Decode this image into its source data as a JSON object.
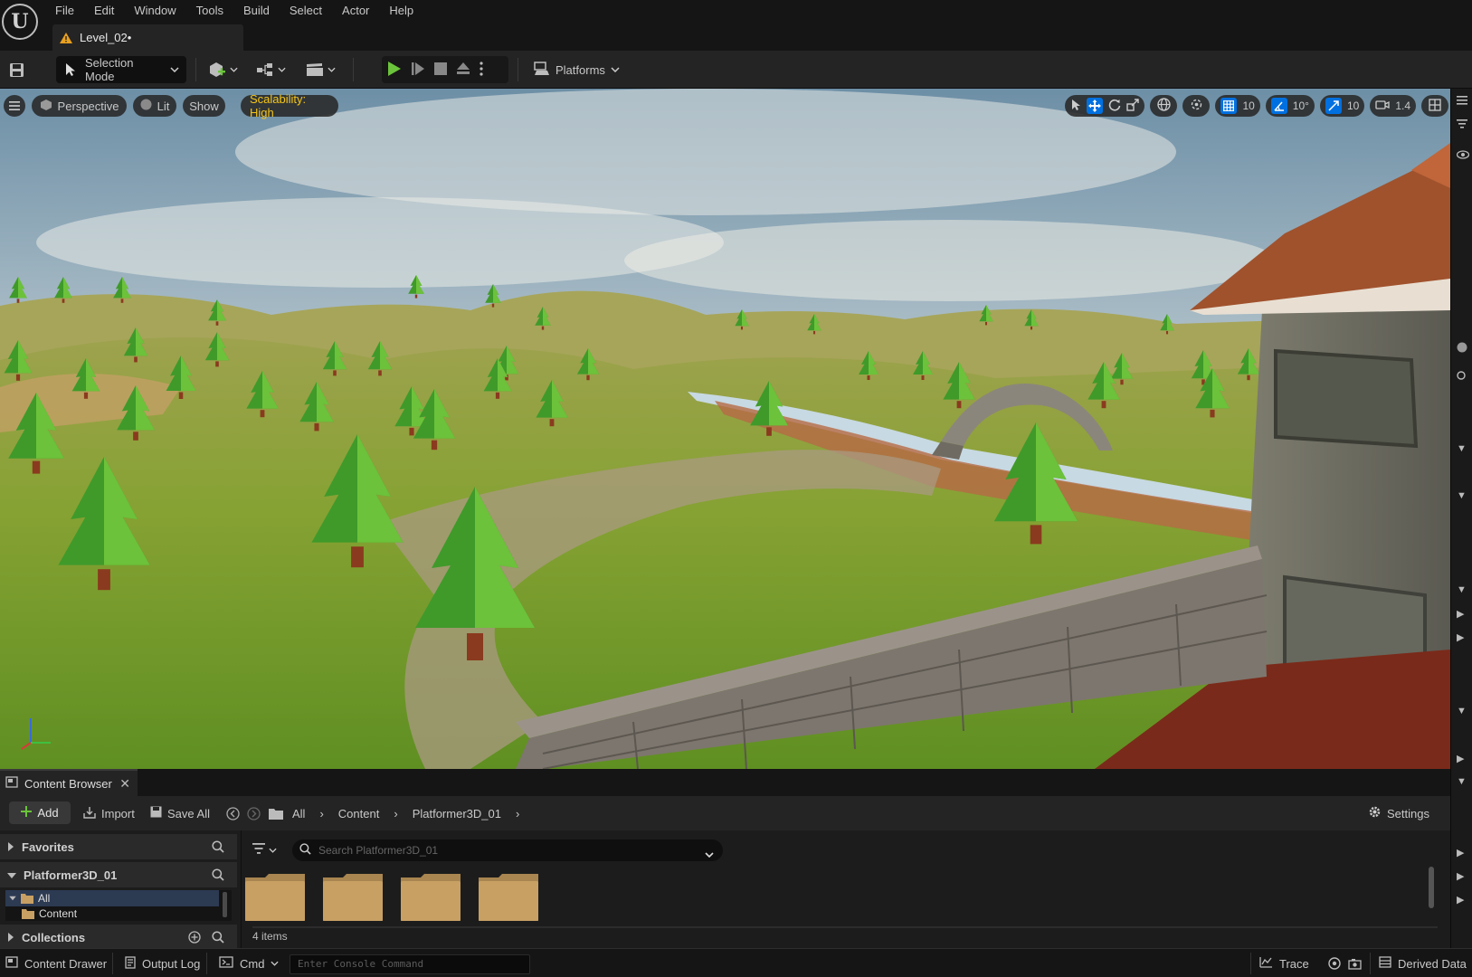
{
  "menubar": {
    "items": [
      "File",
      "Edit",
      "Window",
      "Tools",
      "Build",
      "Select",
      "Actor",
      "Help"
    ],
    "level_tab": "Level_02•"
  },
  "toolbar": {
    "selection_mode": "Selection Mode",
    "platforms": "Platforms"
  },
  "viewport": {
    "perspective": "Perspective",
    "lit": "Lit",
    "show": "Show",
    "scalability": "Scalability: High",
    "grid_snap": "10",
    "rotation_snap": "10°",
    "scale_snap": "10",
    "camera_speed": "1.4"
  },
  "content_browser": {
    "tab_title": "Content Browser",
    "add": "Add",
    "import": "Import",
    "save_all": "Save All",
    "breadcrumb": [
      "All",
      "Content",
      "Platformer3D_01"
    ],
    "settings": "Settings",
    "favorites": "Favorites",
    "project": "Platformer3D_01",
    "tree": [
      "All",
      "Content"
    ],
    "collections": "Collections",
    "search_placeholder": "Search Platformer3D_01",
    "item_count": "4 items"
  },
  "statusbar": {
    "content_drawer": "Content Drawer",
    "output_log": "Output Log",
    "cmd": "Cmd",
    "console_placeholder": "Enter Console Command",
    "trace": "Trace",
    "derived_data": "Derived Data"
  },
  "colors": {
    "accent_blue": "#0070e0",
    "play_green": "#6bc43b",
    "scalability_yellow": "#f5c518",
    "folder_tan": "#c8a064"
  }
}
